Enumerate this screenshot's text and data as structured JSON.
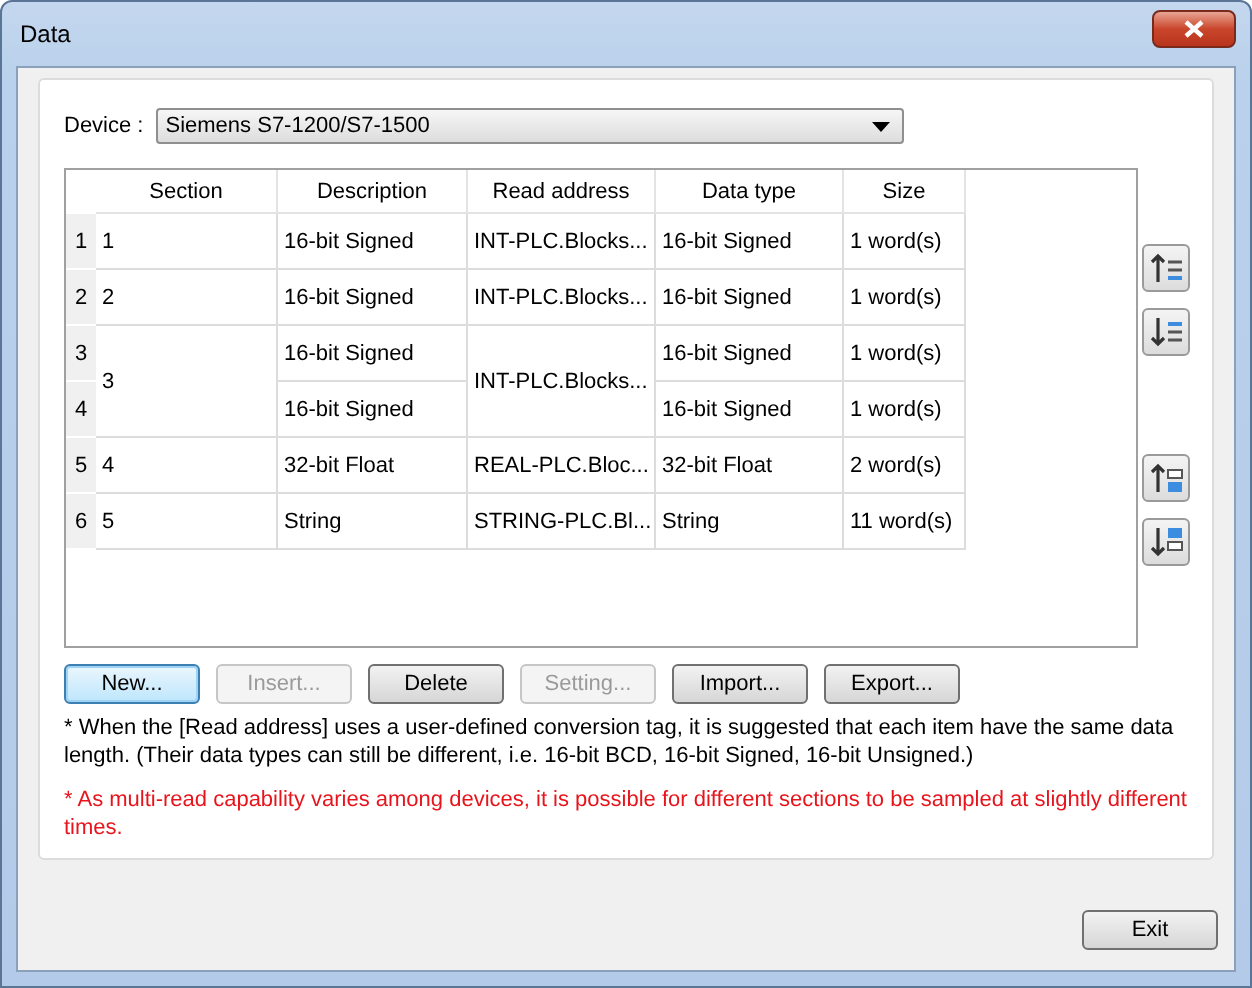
{
  "window": {
    "title": "Data"
  },
  "device": {
    "label": "Device :",
    "value": "Siemens S7-1200/S7-1500"
  },
  "table": {
    "columns": [
      "Section",
      "Description",
      "Read address",
      "Data type",
      "Size"
    ],
    "groups": [
      {
        "section": "1",
        "read_address": "INT-PLC.Blocks...",
        "items": [
          {
            "number": "1",
            "description": "16-bit Signed",
            "data_type": "16-bit Signed",
            "size": "1 word(s)"
          }
        ]
      },
      {
        "section": "2",
        "read_address": "INT-PLC.Blocks...",
        "items": [
          {
            "number": "2",
            "description": "16-bit Signed",
            "data_type": "16-bit Signed",
            "size": "1 word(s)"
          }
        ]
      },
      {
        "section": "3",
        "read_address": "INT-PLC.Blocks...",
        "items": [
          {
            "number": "3",
            "description": "16-bit Signed",
            "data_type": "16-bit Signed",
            "size": "1 word(s)"
          },
          {
            "number": "4",
            "description": "16-bit Signed",
            "data_type": "16-bit Signed",
            "size": "1 word(s)"
          }
        ]
      },
      {
        "section": "4",
        "read_address": "REAL-PLC.Bloc...",
        "items": [
          {
            "number": "5",
            "description": "32-bit Float",
            "data_type": "32-bit Float",
            "size": "2 word(s)"
          }
        ]
      },
      {
        "section": "5",
        "read_address": "STRING-PLC.Bl...",
        "items": [
          {
            "number": "6",
            "description": "String",
            "data_type": "String",
            "size": "11 word(s)"
          }
        ]
      }
    ]
  },
  "side_buttons": [
    {
      "kind": "up"
    },
    {
      "kind": "down"
    },
    {
      "kind": "top"
    },
    {
      "kind": "bottom"
    }
  ],
  "buttons": [
    {
      "label": "New...",
      "disabled": false,
      "focused": true
    },
    {
      "label": "Insert...",
      "disabled": true,
      "focused": false
    },
    {
      "label": "Delete",
      "disabled": false,
      "focused": false
    },
    {
      "label": "Setting...",
      "disabled": true,
      "focused": false
    },
    {
      "label": "Import...",
      "disabled": false,
      "focused": false
    },
    {
      "label": "Export...",
      "disabled": false,
      "focused": false
    }
  ],
  "notes": [
    {
      "text": "* When the [Read address] uses a user-defined conversion tag, it is suggested that each item have the same data length. (Their data types can still be different, i.e. 16-bit BCD, 16-bit Signed, 16-bit Unsigned.)",
      "warning": false
    },
    {
      "text": "* As multi-read capability varies among devices, it is possible for different sections to be sampled at slightly different times.",
      "warning": true
    }
  ],
  "exit_button": {
    "label": "Exit"
  }
}
